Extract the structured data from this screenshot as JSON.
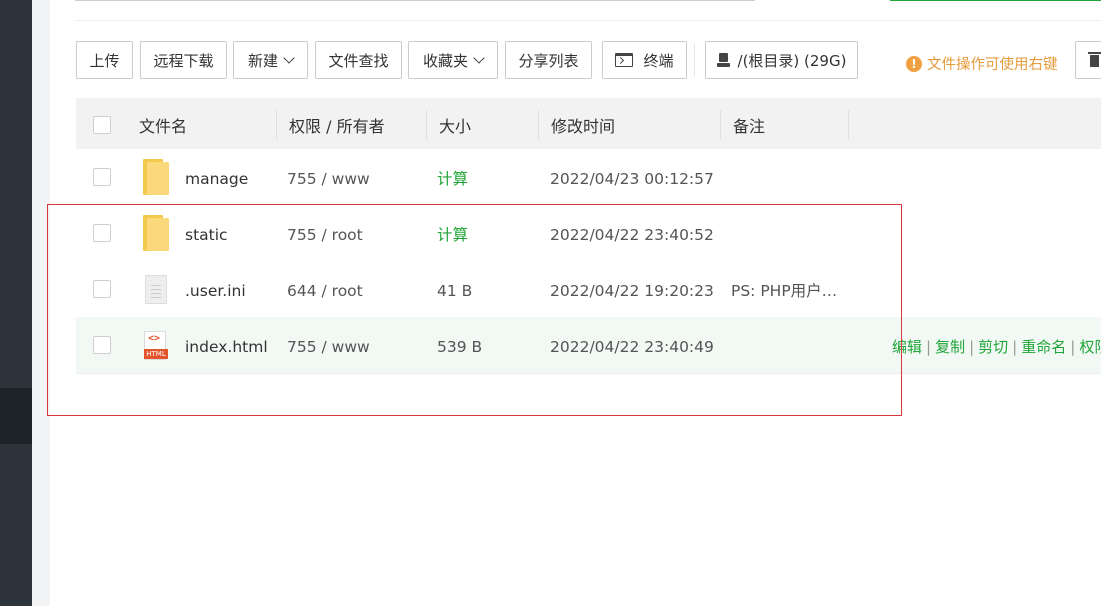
{
  "toolbar": {
    "upload": "上传",
    "remote_download": "远程下载",
    "new": "新建",
    "file_search": "文件查找",
    "favorites": "收藏夹",
    "share_list": "分享列表",
    "terminal": "终端",
    "root_path": "/(根目录) (29G)",
    "tip": "文件操作可使用右键"
  },
  "table": {
    "headers": {
      "name": "文件名",
      "permission": "权限 / 所有者",
      "size": "大小",
      "modified": "修改时间",
      "note": "备注"
    },
    "rows": [
      {
        "type": "folder",
        "name": "manage",
        "permission": "755 / www",
        "size": "计算",
        "modified": "2022/04/23 00:12:57",
        "note": ""
      },
      {
        "type": "folder",
        "name": "static",
        "permission": "755 / root",
        "size": "计算",
        "modified": "2022/04/22 23:40:52",
        "note": ""
      },
      {
        "type": "ini",
        "name": ".user.ini",
        "permission": "644 / root",
        "size": "41 B",
        "modified": "2022/04/22 19:20:23",
        "note": "PS: PHP用户…"
      },
      {
        "type": "html",
        "name": "index.html",
        "permission": "755 / www",
        "size": "539 B",
        "modified": "2022/04/22 23:40:49",
        "note": ""
      }
    ],
    "row_actions": {
      "edit": "编辑",
      "copy": "复制",
      "cut": "剪切",
      "rename": "重命名",
      "permission": "权限"
    },
    "file_badge_html": "HTML",
    "file_badge_code": "<>"
  },
  "colors": {
    "accent": "#20a53a",
    "tip": "#e69b3b",
    "highlight_box": "#d9363e"
  }
}
